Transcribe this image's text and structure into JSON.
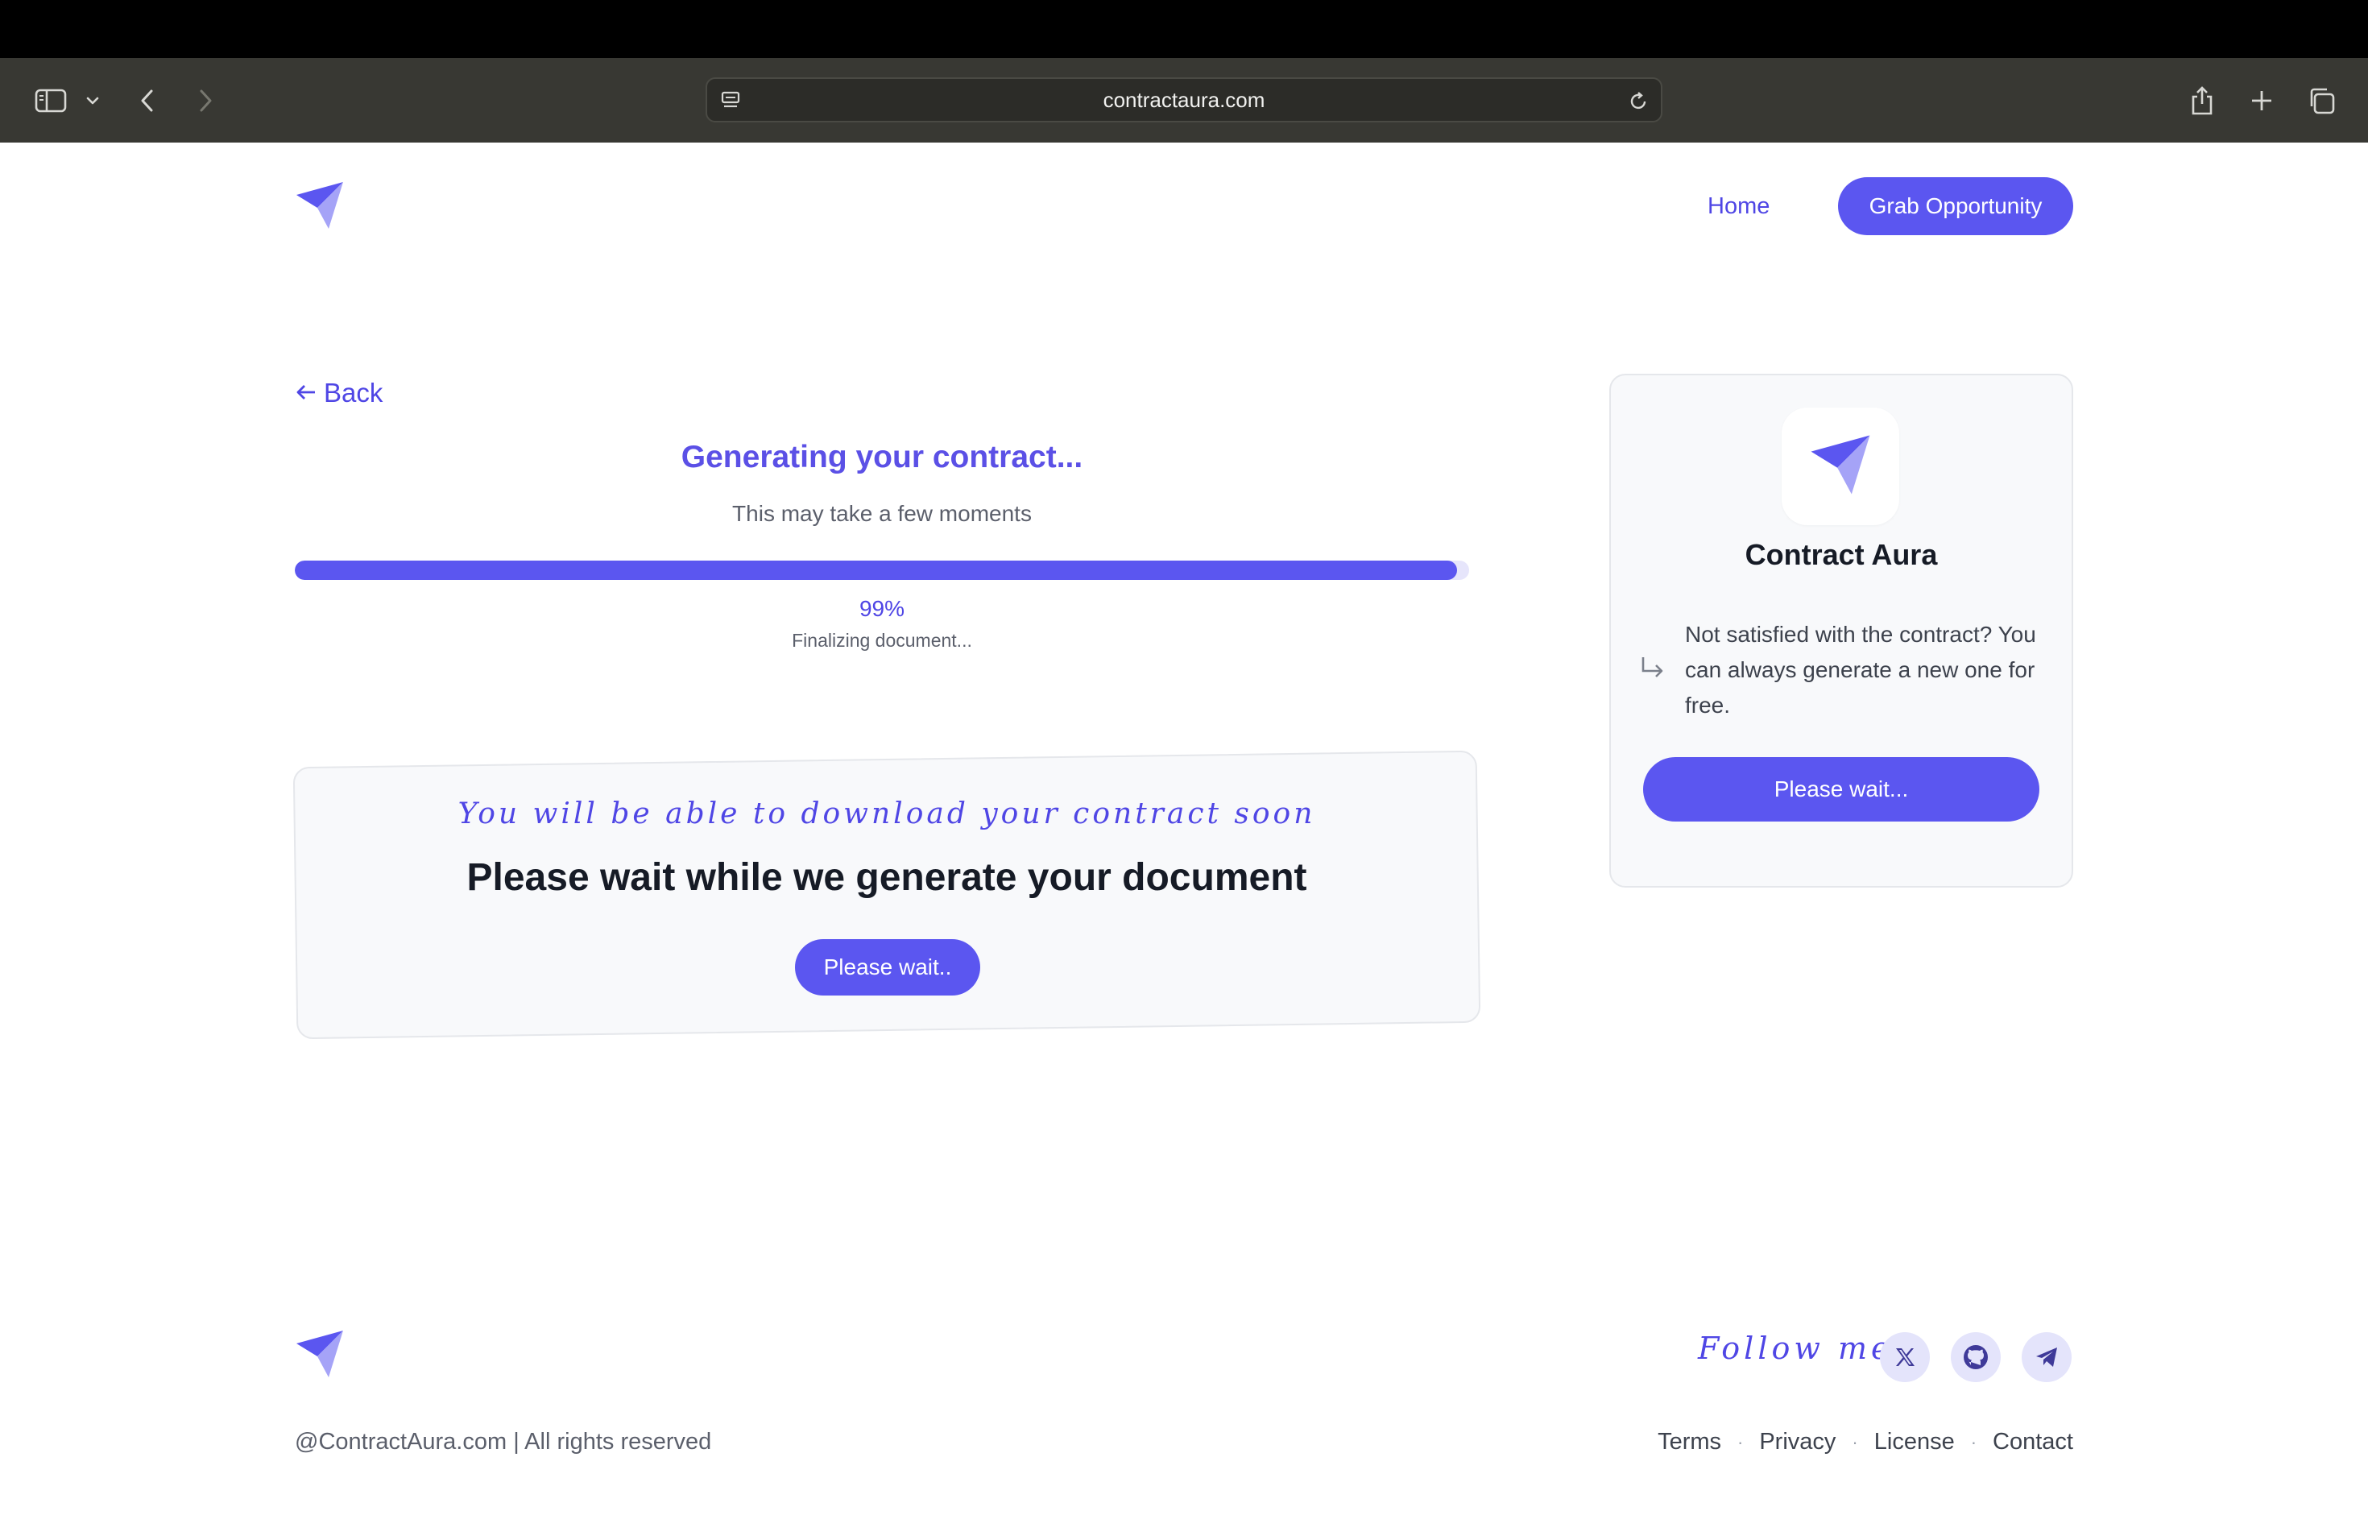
{
  "browser": {
    "url": "contractaura.com"
  },
  "header": {
    "nav_home": "Home",
    "cta": "Grab Opportunity"
  },
  "main": {
    "back": "Back",
    "title": "Generating your contract...",
    "subtitle": "This may take a few moments",
    "progress_percent": 99,
    "progress_label": "99%",
    "status": "Finalizing document...",
    "script_line": "You will be able to download your contract soon",
    "heading": "Please wait while we generate your document",
    "wait_button": "Please wait.."
  },
  "sidebar_card": {
    "app_name": "Contract Aura",
    "message": "Not satisfied with the contract? You can always generate a new one for free.",
    "button": "Please wait..."
  },
  "footer": {
    "follow": "Follow me",
    "social": [
      "x-icon",
      "github-icon",
      "telegram-icon"
    ],
    "copyright": "@ContractAura.com | All rights reserved",
    "links": [
      "Terms",
      "Privacy",
      "License",
      "Contact"
    ]
  },
  "colors": {
    "accent": "#5b56f0",
    "accent_text": "#4f46e5",
    "chrome": "#383833",
    "card_bg": "#f8f9fb"
  }
}
